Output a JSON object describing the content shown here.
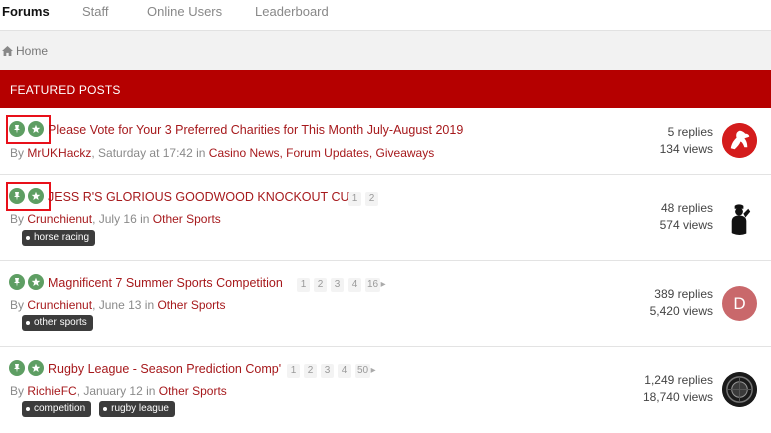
{
  "nav": {
    "tabs": [
      {
        "label": "Forums",
        "active": true
      },
      {
        "label": "Staff",
        "active": false
      },
      {
        "label": "Online Users",
        "active": false
      },
      {
        "label": "Leaderboard",
        "active": false
      }
    ]
  },
  "breadcrumb": {
    "home": "Home"
  },
  "featured": {
    "title": "FEATURED POSTS"
  },
  "colors": {
    "accent": "#b50000",
    "link": "#a6191c",
    "badge": "#5e9e63",
    "highlight": "#e8101a"
  },
  "topics": [
    {
      "title": "Please Vote for Your 3 Preferred Charities for This Month July-August 2019",
      "by": "By",
      "author": "MrUKHackz",
      "date": ", Saturday at 17:42 in ",
      "forums": "Casino News, Forum Updates, Giveaways",
      "pages": [],
      "tags": [],
      "replies": "5 replies",
      "views": "134 views",
      "avatar": "horse-logo-avatar"
    },
    {
      "title": "JESS R'S GLORIOUS GOODWOOD KNOCKOUT CUP",
      "by": "By",
      "author": "Crunchienut",
      "date": ", July 16 in ",
      "forums": "Other Sports",
      "pages": [
        "1",
        "2"
      ],
      "tags": [
        "horse racing"
      ],
      "replies": "48 replies",
      "views": "574 views",
      "avatar": "saluting-soldier-avatar"
    },
    {
      "title": "Magnificent 7 Summer Sports Competition",
      "by": "By",
      "author": "Crunchienut",
      "date": ", June 13 in ",
      "forums": "Other Sports",
      "pages": [
        "1",
        "2",
        "3",
        "4",
        "16"
      ],
      "tags": [
        "other sports"
      ],
      "replies": "389 replies",
      "views": "5,420 views",
      "avatar": "D"
    },
    {
      "title": "Rugby League - Season Prediction Comp'",
      "by": "By",
      "author": "RichieFC",
      "date": ", January 12 in ",
      "forums": "Other Sports",
      "pages": [
        "1",
        "2",
        "3",
        "4",
        "50"
      ],
      "tags": [
        "competition",
        "rugby league"
      ],
      "replies": "1,249 replies",
      "views": "18,740 views",
      "avatar": "dark-emblem-avatar"
    }
  ]
}
